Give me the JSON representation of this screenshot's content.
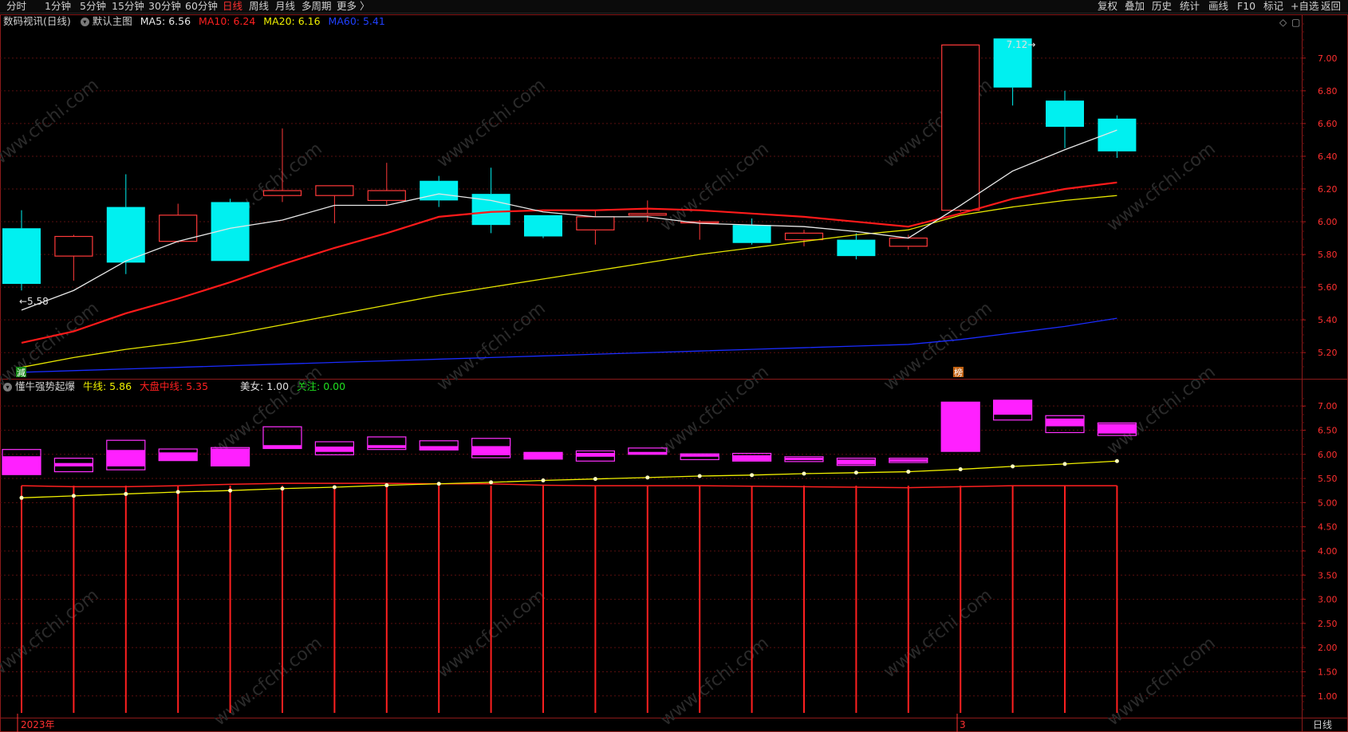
{
  "periods": [
    "分时",
    "1分钟",
    "5分钟",
    "15分钟",
    "30分钟",
    "60分钟",
    "日线",
    "周线",
    "月线",
    "多周期",
    "更多 〉"
  ],
  "active_period": "日线",
  "tools": [
    "复权",
    "叠加",
    "历史",
    "统计",
    "画线",
    "F10",
    "标记",
    "+自选",
    "返回"
  ],
  "main": {
    "title": "数码视讯(日线)",
    "indicator_name": "默认主图",
    "ma": [
      {
        "label": "MA5: 6.56",
        "color": "#e8e8e8"
      },
      {
        "label": "MA10: 6.24",
        "color": "#ff2020"
      },
      {
        "label": "MA20: 6.16",
        "color": "#f0f000"
      },
      {
        "label": "MA60: 5.41",
        "color": "#2040ff"
      }
    ],
    "low_mark": "5.58",
    "high_mark": "7.12",
    "badge_left": "減",
    "badge_right": "榜"
  },
  "sub": {
    "indicator_name": "懂牛强势起爆",
    "items": [
      {
        "label": "牛线: 5.86",
        "color": "#f0f000"
      },
      {
        "label": "大盘中线: 5.35",
        "color": "#ff2020"
      },
      {
        "label": "美女: 1.00",
        "color": "#e0e0e0"
      },
      {
        "label": "关注: 0.00",
        "color": "#20e020"
      }
    ]
  },
  "axis_main": [
    "7.00",
    "6.80",
    "6.60",
    "6.40",
    "6.20",
    "6.00",
    "5.80",
    "5.60",
    "5.40",
    "5.20"
  ],
  "axis_sub": [
    "7.00",
    "6.50",
    "6.00",
    "5.50",
    "5.00",
    "4.50",
    "4.00",
    "3.50",
    "3.00",
    "2.50",
    "2.00",
    "1.50",
    "1.00"
  ],
  "bottom": {
    "year": "2023年",
    "month": "3",
    "period": "日线"
  },
  "watermark": "www.cfchi.com",
  "chart_data": {
    "type": "candlestick",
    "candles": [
      {
        "o": 5.96,
        "h": 6.07,
        "l": 5.58,
        "c": 5.62
      },
      {
        "o": 5.79,
        "h": 5.92,
        "l": 5.64,
        "c": 5.91
      },
      {
        "o": 6.09,
        "h": 6.29,
        "l": 5.68,
        "c": 5.75
      },
      {
        "o": 5.88,
        "h": 6.11,
        "l": 5.87,
        "c": 6.04
      },
      {
        "o": 6.12,
        "h": 6.14,
        "l": 5.76,
        "c": 5.76
      },
      {
        "o": 6.16,
        "h": 6.57,
        "l": 6.12,
        "c": 6.19
      },
      {
        "o": 6.16,
        "h": 6.22,
        "l": 5.99,
        "c": 6.22
      },
      {
        "o": 6.13,
        "h": 6.36,
        "l": 6.1,
        "c": 6.19
      },
      {
        "o": 6.25,
        "h": 6.28,
        "l": 6.09,
        "c": 6.13
      },
      {
        "o": 6.17,
        "h": 6.33,
        "l": 5.93,
        "c": 5.98
      },
      {
        "o": 6.04,
        "h": 6.04,
        "l": 5.9,
        "c": 5.91
      },
      {
        "o": 5.95,
        "h": 6.07,
        "l": 5.86,
        "c": 6.03
      },
      {
        "o": 6.04,
        "h": 6.13,
        "l": 6.0,
        "c": 6.05
      },
      {
        "o": 6.0,
        "h": 6.01,
        "l": 5.89,
        "c": 6.0
      },
      {
        "o": 5.98,
        "h": 6.02,
        "l": 5.86,
        "c": 5.87
      },
      {
        "o": 5.89,
        "h": 5.95,
        "l": 5.85,
        "c": 5.93
      },
      {
        "o": 5.89,
        "h": 5.93,
        "l": 5.77,
        "c": 5.79
      },
      {
        "o": 5.85,
        "h": 5.92,
        "l": 5.83,
        "c": 5.9
      },
      {
        "o": 6.07,
        "h": 7.08,
        "l": 6.06,
        "c": 7.08
      },
      {
        "o": 7.12,
        "h": 7.12,
        "l": 6.71,
        "c": 6.82
      },
      {
        "o": 6.74,
        "h": 6.8,
        "l": 6.45,
        "c": 6.58
      },
      {
        "o": 6.63,
        "h": 6.65,
        "l": 6.39,
        "c": 6.43
      }
    ],
    "ma5": [
      5.46,
      5.58,
      5.76,
      5.88,
      5.96,
      6.01,
      6.1,
      6.1,
      6.17,
      6.13,
      6.06,
      6.03,
      6.03,
      5.99,
      5.98,
      5.97,
      5.94,
      5.9,
      6.1,
      6.31,
      6.44,
      6.56
    ],
    "ma10": [
      5.26,
      5.33,
      5.44,
      5.53,
      5.63,
      5.74,
      5.84,
      5.93,
      6.03,
      6.06,
      6.07,
      6.07,
      6.08,
      6.07,
      6.05,
      6.03,
      6.0,
      5.97,
      6.05,
      6.14,
      6.2,
      6.24
    ],
    "ma20": [
      5.11,
      5.17,
      5.22,
      5.26,
      5.31,
      5.37,
      5.43,
      5.49,
      5.55,
      5.6,
      5.65,
      5.7,
      5.75,
      5.8,
      5.84,
      5.88,
      5.92,
      5.95,
      6.04,
      6.09,
      6.13,
      6.16
    ],
    "ma60": [
      5.08,
      5.09,
      5.1,
      5.11,
      5.12,
      5.13,
      5.14,
      5.15,
      5.16,
      5.17,
      5.18,
      5.19,
      5.2,
      5.21,
      5.22,
      5.23,
      5.24,
      5.25,
      5.28,
      5.32,
      5.36,
      5.41
    ],
    "ylim": [
      5.05,
      7.16
    ],
    "sub": {
      "ylim": [
        0.65,
        7.25
      ],
      "boxes": [
        {
          "top": 6.1,
          "bottom": 5.58,
          "ftop": 5.96,
          "fbot": 5.58
        },
        {
          "top": 5.92,
          "bottom": 5.64,
          "ftop": 5.82,
          "fbot": 5.75
        },
        {
          "top": 6.29,
          "bottom": 5.68,
          "ftop": 6.09,
          "fbot": 5.75
        },
        {
          "top": 6.11,
          "bottom": 5.87,
          "ftop": 6.04,
          "fbot": 5.88
        },
        {
          "top": 6.14,
          "bottom": 5.76,
          "ftop": 6.12,
          "fbot": 5.76
        },
        {
          "top": 6.57,
          "bottom": 6.12,
          "ftop": 6.19,
          "fbot": 6.12
        },
        {
          "top": 6.26,
          "bottom": 5.99,
          "ftop": 6.16,
          "fbot": 6.05
        },
        {
          "top": 6.36,
          "bottom": 6.1,
          "ftop": 6.19,
          "fbot": 6.13
        },
        {
          "top": 6.28,
          "bottom": 6.09,
          "ftop": 6.17,
          "fbot": 6.09
        },
        {
          "top": 6.33,
          "bottom": 5.93,
          "ftop": 6.17,
          "fbot": 5.98
        },
        {
          "top": 6.04,
          "bottom": 5.9,
          "ftop": 6.04,
          "fbot": 5.91
        },
        {
          "top": 6.07,
          "bottom": 5.86,
          "ftop": 6.03,
          "fbot": 5.95
        },
        {
          "top": 6.13,
          "bottom": 6.0,
          "ftop": 6.05,
          "fbot": 6.04
        },
        {
          "top": 6.01,
          "bottom": 5.89,
          "ftop": 6.0,
          "fbot": 5.99
        },
        {
          "top": 6.02,
          "bottom": 5.86,
          "ftop": 5.98,
          "fbot": 5.87
        },
        {
          "top": 5.95,
          "bottom": 5.85,
          "ftop": 5.93,
          "fbot": 5.89
        },
        {
          "top": 5.92,
          "bottom": 5.77,
          "ftop": 5.89,
          "fbot": 5.79
        },
        {
          "top": 5.92,
          "bottom": 5.83,
          "ftop": 5.9,
          "fbot": 5.85
        },
        {
          "top": 7.08,
          "bottom": 6.06,
          "ftop": 7.08,
          "fbot": 6.07
        },
        {
          "top": 7.12,
          "bottom": 6.71,
          "ftop": 7.12,
          "fbot": 6.82
        },
        {
          "top": 6.8,
          "bottom": 6.45,
          "ftop": 6.74,
          "fbot": 6.58
        },
        {
          "top": 6.65,
          "bottom": 6.39,
          "ftop": 6.63,
          "fbot": 6.43
        }
      ],
      "niu": [
        5.1,
        5.14,
        5.18,
        5.22,
        5.25,
        5.29,
        5.32,
        5.36,
        5.39,
        5.42,
        5.46,
        5.49,
        5.52,
        5.55,
        5.57,
        5.6,
        5.62,
        5.64,
        5.69,
        5.75,
        5.8,
        5.86
      ],
      "dapan": [
        5.35,
        5.33,
        5.33,
        5.35,
        5.38,
        5.4,
        5.4,
        5.4,
        5.39,
        5.39,
        5.36,
        5.35,
        5.35,
        5.35,
        5.34,
        5.33,
        5.32,
        5.31,
        5.33,
        5.35,
        5.35,
        5.35
      ],
      "bar_value": 5.35
    }
  }
}
